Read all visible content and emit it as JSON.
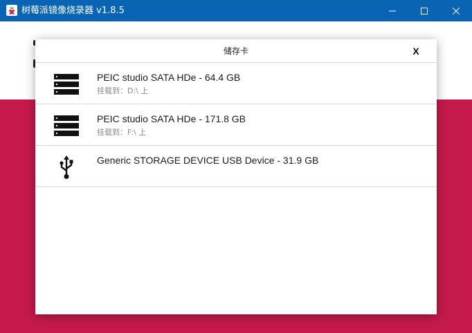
{
  "window": {
    "title": "树莓派镜像烧录器 v1.8.5",
    "accent_color": "#0a64b4",
    "logo_icon": "raspberry-pi-logo"
  },
  "background": {
    "top_color": "#ffffff",
    "bottom_color": "#c51a4a"
  },
  "dialog": {
    "title": "储存卡",
    "close_label": "X"
  },
  "devices": [
    {
      "name": "PEIC studio SATA HDe - 64.4 GB",
      "mount": "挂载到：D:\\ 上",
      "icon": "hard-drive-icon"
    },
    {
      "name": "PEIC studio SATA HDe - 171.8 GB",
      "mount": "挂载到：F:\\ 上",
      "icon": "hard-drive-icon"
    },
    {
      "name": "Generic STORAGE DEVICE USB Device - 31.9 GB",
      "mount": "",
      "icon": "usb-icon"
    }
  ]
}
